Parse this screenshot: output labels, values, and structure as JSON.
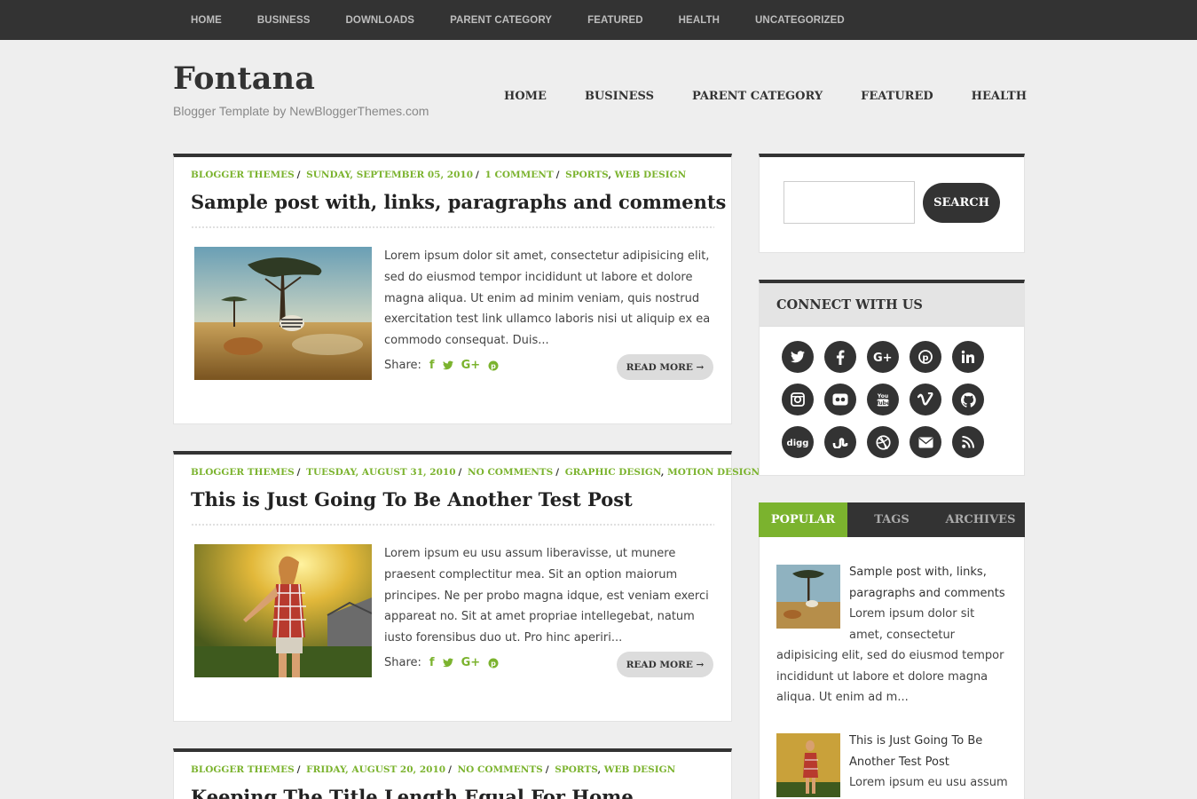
{
  "topnav": [
    "HOME",
    "BUSINESS",
    "DOWNLOADS",
    "PARENT CATEGORY",
    "FEATURED",
    "HEALTH",
    "UNCATEGORIZED"
  ],
  "site": {
    "title": "Fontana",
    "tagline": "Blogger Template by NewBloggerThemes.com"
  },
  "mainnav": [
    "HOME",
    "BUSINESS",
    "PARENT CATEGORY",
    "FEATURED",
    "HEALTH"
  ],
  "posts": [
    {
      "author": "BLOGGER THEMES",
      "date": "SUNDAY, SEPTEMBER 05, 2010",
      "comments": "1 COMMENT",
      "labels": [
        "SPORTS",
        "WEB DESIGN"
      ],
      "title": "Sample post with, links, paragraphs and comments",
      "excerpt": "Lorem ipsum dolor sit amet, consectetur adipisicing elit, sed do eiusmod tempor incididunt ut labore et dolore magna aliqua. Ut enim ad minim veniam, quis nostrud exercitation test link ullamco laboris nisi ut aliquip ex ea commodo consequat. Duis...",
      "share_label": "Share:",
      "read_more": "READ MORE →"
    },
    {
      "author": "BLOGGER THEMES",
      "date": "TUESDAY, AUGUST 31, 2010",
      "comments": "NO COMMENTS",
      "labels": [
        "GRAPHIC DESIGN",
        "MOTION DESIGN"
      ],
      "title": "This is Just Going To Be Another Test Post",
      "excerpt": "Lorem ipsum eu usu assum liberavisse, ut munere praesent complectitur mea. Sit an option maiorum principes. Ne per probo magna idque, est veniam exerci appareat no. Sit at amet propriae intellegebat, natum iusto forensibus duo ut. Pro hinc aperiri...",
      "share_label": "Share:",
      "read_more": "READ MORE →"
    },
    {
      "author": "BLOGGER THEMES",
      "date": "FRIDAY, AUGUST 20, 2010",
      "comments": "NO COMMENTS",
      "labels": [
        "SPORTS",
        "WEB DESIGN"
      ],
      "title": "Keeping The Title Length Equal For Home"
    }
  ],
  "sidebar": {
    "search_button": "SEARCH",
    "search_value": "",
    "connect_title": "CONNECT WITH US",
    "social_icons": [
      "twitter-icon",
      "facebook-icon",
      "google-plus-icon",
      "pinterest-icon",
      "linkedin-icon",
      "instagram-icon",
      "flickr-icon",
      "youtube-icon",
      "vimeo-icon",
      "github-icon",
      "digg-icon",
      "stumbleupon-icon",
      "dribbble-icon",
      "email-icon",
      "rss-icon"
    ],
    "tabs": [
      "POPULAR",
      "TAGS",
      "ARCHIVES"
    ],
    "popular": [
      {
        "title": "Sample post with, links, paragraphs and comments",
        "snippet": "Lorem ipsum dolor sit amet, consectetur adipisicing elit, sed do eiusmod tempor incididunt ut labore et dolore magna aliqua. Ut enim ad m..."
      },
      {
        "title": "This is Just Going To Be Another Test Post",
        "snippet": "Lorem ipsum eu usu assum"
      }
    ]
  },
  "colors": {
    "accent": "#7bb32e",
    "dark": "#333333",
    "background": "#eeeeee"
  }
}
